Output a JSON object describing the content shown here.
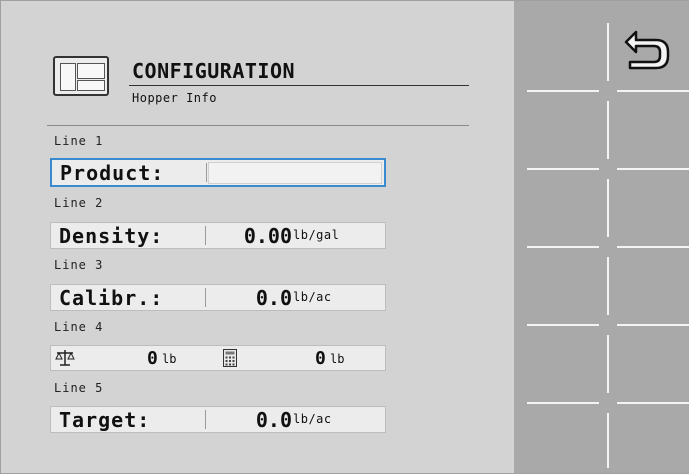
{
  "header": {
    "title": "CONFIGURATION",
    "subtitle": "Hopper Info"
  },
  "lines": [
    {
      "label": "Line 1",
      "name": "Product:",
      "value": "",
      "unit": ""
    },
    {
      "label": "Line 2",
      "name": "Density:",
      "value": "0.00",
      "unit": "lb/gal"
    },
    {
      "label": "Line 3",
      "name": "Calibr.:",
      "value": "0.0",
      "unit": "lb/ac"
    },
    {
      "label": "Line 4",
      "weight_value": "0",
      "weight_unit": "lb",
      "calc_value": "0",
      "calc_unit": "lb"
    },
    {
      "label": "Line 5",
      "name": "Target:",
      "value": "0.0",
      "unit": "lb/ac"
    }
  ],
  "icons": {
    "page": "configuration-page-icon",
    "back": "back-arrow-icon",
    "scale": "scale-icon",
    "calculator": "calculator-icon"
  },
  "colors": {
    "focus": "#3a8ad0",
    "softkey_panel": "#a9a9a9",
    "background": "#d3d3d3"
  }
}
